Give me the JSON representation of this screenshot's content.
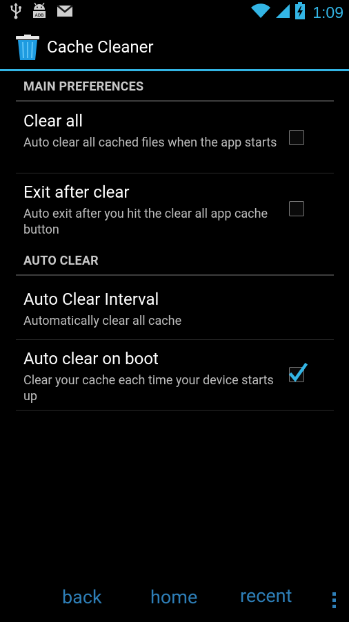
{
  "status_bar": {
    "time": "1:09",
    "icons": [
      "usb-icon",
      "android-debug-icon",
      "gmail-icon",
      "wifi-icon",
      "signal-icon",
      "battery-charging-icon"
    ]
  },
  "action_bar": {
    "title": "Cache Cleaner",
    "icon": "trash-can-icon"
  },
  "preferences": {
    "category_main": "MAIN PREFERENCES",
    "clear_all": {
      "title": "Clear all",
      "summary": "Auto clear all cached files when the app starts",
      "checked": false
    },
    "exit_after_clear": {
      "title": "Exit after clear",
      "summary": "Auto exit after you hit the clear all app cache button",
      "checked": false
    },
    "category_auto": "AUTO CLEAR",
    "auto_clear_interval": {
      "title": "Auto Clear Interval",
      "summary": "Automatically clear all cache"
    },
    "auto_clear_on_boot": {
      "title": "Auto clear on boot",
      "summary": "Clear your cache each time your device starts up",
      "checked": true
    }
  },
  "navigation": {
    "back": "back",
    "home": "home",
    "recent": "recent",
    "menu_icon": "overflow-menu-icon"
  },
  "colors": {
    "accent": "#33b5e5",
    "nav_text": "#2e7fb8",
    "background": "#000000"
  }
}
